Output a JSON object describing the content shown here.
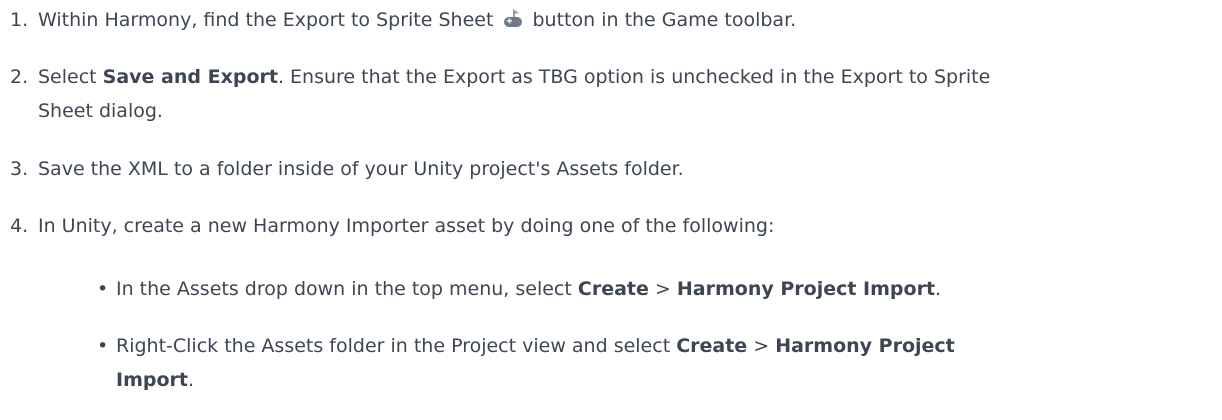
{
  "steps": [
    {
      "num": "1.",
      "pre": "Within Harmony, find the Export to Sprite Sheet",
      "icon": "gamepad-export-icon",
      "post": "button in the Game toolbar."
    },
    {
      "num": "2.",
      "t1": "Select ",
      "b1": "Save and Export",
      "t2": ". Ensure that the Export as TBG option is unchecked in the Export to Sprite",
      "t3": "Sheet dialog."
    },
    {
      "num": "3.",
      "text": "Save the XML to a folder inside of your Unity project's Assets folder."
    },
    {
      "num": "4.",
      "text": "In Unity, create a new Harmony Importer asset by doing one of the following:"
    }
  ],
  "bullets": [
    {
      "dot": "•",
      "t1": "In the Assets drop down in the top menu, select ",
      "b1": "Create",
      "t2": " > ",
      "b2": "Harmony Project Import",
      "t3": "."
    },
    {
      "dot": "•",
      "t1": "Right-Click the Assets folder in the Project view and select ",
      "b1": "Create",
      "t2": " > ",
      "b2": "Harmony Project",
      "b3": "Import",
      "t3": "."
    }
  ]
}
